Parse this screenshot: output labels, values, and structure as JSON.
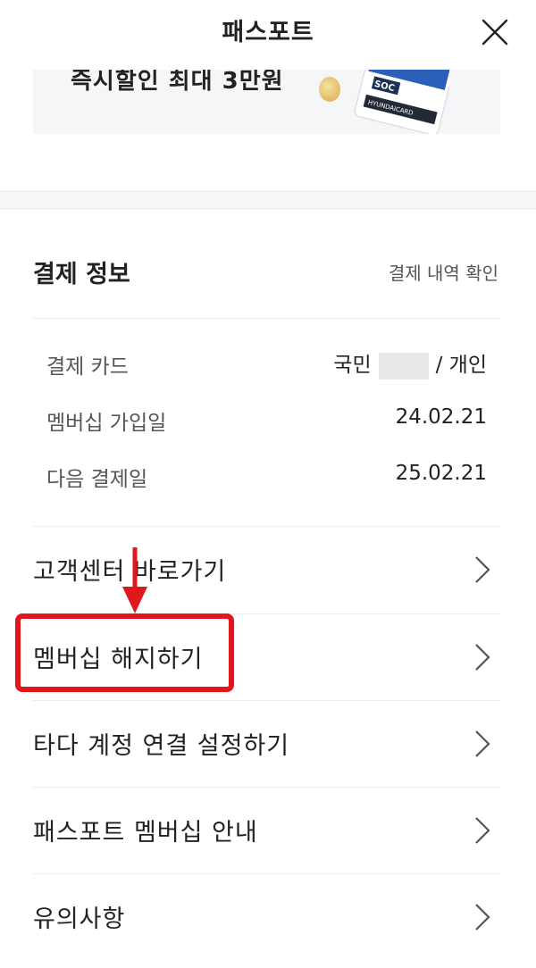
{
  "header": {
    "title": "패스포트",
    "close_icon": "close-icon"
  },
  "banner": {
    "text": "즉시할인 최대 3만원",
    "card_text_1": "SOC",
    "card_text_2": "HYUNDAICARD"
  },
  "payment": {
    "title": "결제 정보",
    "history_link": "결제 내역 확인",
    "rows": [
      {
        "label": "결제 카드",
        "value_prefix": "국민",
        "value_suffix": "/ 개인"
      },
      {
        "label": "멤버십 가입일",
        "value": "24.02.21"
      },
      {
        "label": "다음 결제일",
        "value": "25.02.21"
      }
    ]
  },
  "menu": {
    "items": [
      {
        "label": "고객센터 바로가기"
      },
      {
        "label": "멤버십 해지하기"
      },
      {
        "label": "타다 계정 연결 설정하기"
      },
      {
        "label": "패스포트 멤버십 안내"
      },
      {
        "label": "유의사항"
      }
    ]
  },
  "colors": {
    "annotation": "#e0181d",
    "divider": "#ececec",
    "text_primary": "#222222",
    "text_secondary": "#555555"
  }
}
